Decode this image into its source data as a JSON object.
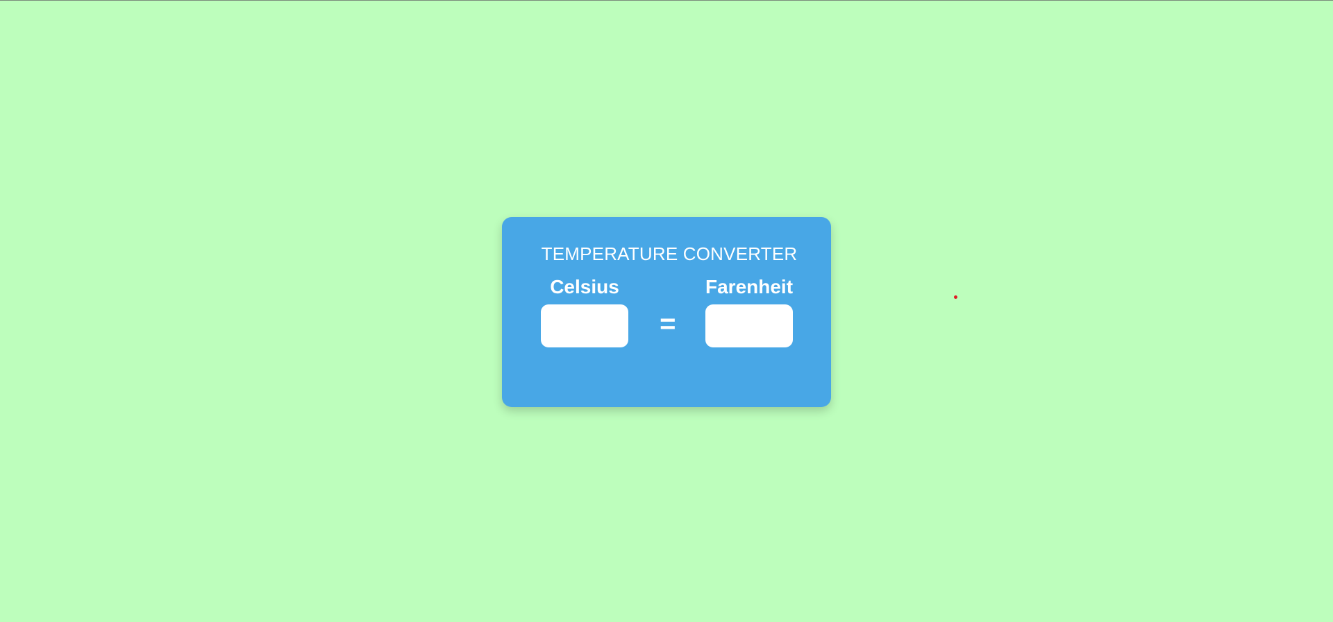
{
  "converter": {
    "title": "TEMPERATURE CONVERTER",
    "celsius": {
      "label": "Celsius",
      "value": ""
    },
    "fahrenheit": {
      "label": "Farenheit",
      "value": ""
    },
    "equals_symbol": "="
  },
  "colors": {
    "page_background": "#bdfebc",
    "card_background": "#48a7e6",
    "text": "#ffffff",
    "input_background": "#ffffff",
    "cursor_marker": "#e01b24"
  }
}
